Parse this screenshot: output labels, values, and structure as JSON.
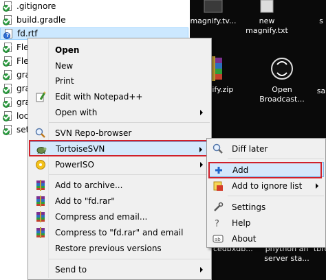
{
  "explorer": {
    "files": [
      {
        "name": ".gitignore",
        "badge": "green"
      },
      {
        "name": "build.gradle",
        "badge": "green"
      },
      {
        "name": "fd.rtf",
        "badge": "blue",
        "selected": true
      },
      {
        "name": "Fle",
        "badge": "green"
      },
      {
        "name": "Fle",
        "badge": "green"
      },
      {
        "name": "gra",
        "badge": "green"
      },
      {
        "name": "gra",
        "badge": "green"
      },
      {
        "name": "gra",
        "badge": "green"
      },
      {
        "name": "loc",
        "badge": "green"
      },
      {
        "name": "set",
        "badge": "green"
      }
    ]
  },
  "desktop": {
    "icons": [
      {
        "label": "magnify.tv...",
        "icon": "video-file-icon"
      },
      {
        "label": "new\nmagnify.txt",
        "icon": "text-file-icon"
      },
      {
        "label": "s",
        "icon": "file-icon"
      },
      {
        "label": "nagnify.zip",
        "icon": "winrar-archive-icon"
      },
      {
        "label": "Open\nBroadcast...",
        "icon": "obs-icon"
      },
      {
        "label": "sa",
        "icon": "file-icon"
      },
      {
        "label": "cedbxdb...",
        "icon": "pdf-icon"
      },
      {
        "label": "pnytnon an\nserver sta...",
        "icon": "file-icon"
      },
      {
        "label": "tbre",
        "icon": "file-icon"
      }
    ]
  },
  "context_menu": {
    "items": [
      {
        "label": "Open",
        "bold": true,
        "icon": ""
      },
      {
        "label": "New",
        "icon": ""
      },
      {
        "label": "Print",
        "icon": ""
      },
      {
        "label": "Edit with Notepad++",
        "icon": "notepad-plus-plus-icon"
      },
      {
        "label": "Open with",
        "icon": "",
        "submenu": true
      },
      {
        "label": "SVN Repo-browser",
        "icon": "repo-browser-icon"
      },
      {
        "label": "TortoiseSVN",
        "icon": "tortoisesvn-icon",
        "submenu": true,
        "highlighted": true
      },
      {
        "label": "PowerISO",
        "icon": "poweriso-icon",
        "submenu": true
      },
      {
        "label": "Add to archive...",
        "icon": "winrar-icon"
      },
      {
        "label": "Add to \"fd.rar\"",
        "icon": "winrar-icon"
      },
      {
        "label": "Compress and email...",
        "icon": "winrar-icon"
      },
      {
        "label": "Compress to \"fd.rar\" and email",
        "icon": "winrar-icon"
      },
      {
        "label": "Restore previous versions",
        "icon": ""
      },
      {
        "label": "Send to",
        "icon": "",
        "submenu": true
      }
    ]
  },
  "tortoise_submenu": {
    "items": [
      {
        "label": "Diff later",
        "icon": "diff-icon"
      },
      {
        "label": "Add",
        "icon": "add-icon",
        "highlighted": true
      },
      {
        "label": "Add to ignore list",
        "icon": "ignore-list-icon",
        "submenu": true
      },
      {
        "label": "Settings",
        "icon": "settings-icon"
      },
      {
        "label": "Help",
        "icon": "help-icon"
      },
      {
        "label": "About",
        "icon": "about-icon"
      }
    ]
  },
  "colors": {
    "highlight_box": "#d0202a",
    "selection_bg": "#cce8ff",
    "desktop_bg": "#0a0a0a"
  }
}
